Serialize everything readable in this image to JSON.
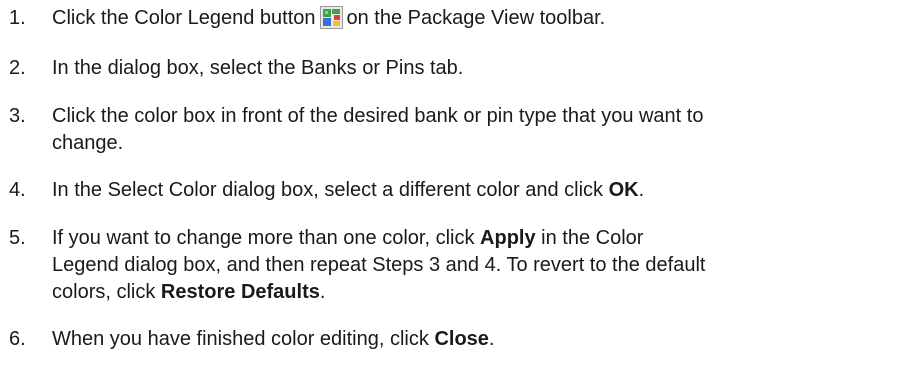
{
  "steps": [
    {
      "number": "1.",
      "before_icon": "Click the Color Legend button",
      "icon": "color-legend-icon",
      "after_icon": "on the Package View toolbar."
    },
    {
      "number": "2.",
      "text": "In the dialog box, select the Banks or Pins tab."
    },
    {
      "number": "3.",
      "line1": "Click the color box in front of the desired bank or pin type that you want to",
      "line2": "change."
    },
    {
      "number": "4.",
      "before_bold": "In the Select Color dialog box, select a different color and click",
      "bold": "OK",
      "after_bold": "."
    },
    {
      "number": "5.",
      "line1_before_bold": "If you want to change more than one color, click",
      "line1_bold": "Apply",
      "line1_after_bold": "in the Color",
      "line2": "Legend dialog box, and then repeat Steps 3 and 4. To revert to the default",
      "line3_before_bold": "colors, click",
      "line3_bold": "Restore Defaults",
      "line3_after_bold": "."
    },
    {
      "number": "6.",
      "before_bold": "When you have finished color editing, click",
      "bold": "Close",
      "after_bold": "."
    }
  ],
  "colors": {
    "text": "#1a1a1a",
    "icon_background": "#e8e8e8",
    "icon_green": "#3fa34d",
    "icon_red": "#e0403a",
    "icon_blue": "#3a6fd8",
    "icon_yellow": "#f0c419"
  }
}
